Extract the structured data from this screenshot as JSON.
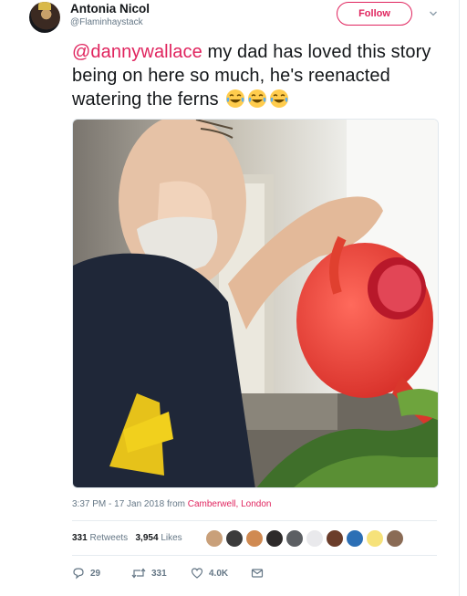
{
  "author": {
    "name": "Antonia Nicol",
    "handle": "@Flaminhaystack"
  },
  "follow_label": "Follow",
  "tweet": {
    "mention": "@dannywallace",
    "text": " my dad has loved this story being on here so much, he's reenacted watering the ferns",
    "emoji": [
      "face-with-tears-of-joy",
      "face-with-tears-of-joy",
      "face-with-tears-of-joy"
    ]
  },
  "meta": {
    "time": "3:37 PM - 17 Jan 2018 from ",
    "place": "Camberwell, London"
  },
  "stats": {
    "retweets_count": "331",
    "retweets_label": "Retweets",
    "likes_count": "3,954",
    "likes_label": "Likes"
  },
  "actions": {
    "replies": "29",
    "retweets": "331",
    "likes": "4.0K"
  },
  "colors": {
    "accent": "#e0245e",
    "secondary_text": "#657786",
    "primary_text": "#14171a",
    "divider": "#e6ecf0"
  }
}
